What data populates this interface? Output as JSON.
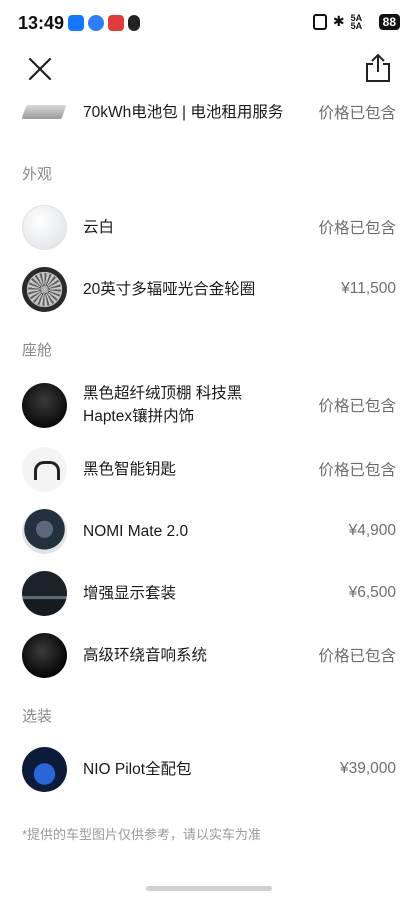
{
  "status_bar": {
    "time": "13:49",
    "battery": "88",
    "signal": "5A 5A"
  },
  "items_top": [
    {
      "name": "70kWh电池包 | 电池租用服务",
      "price": "价格已包含",
      "thumb": "battery-pack"
    }
  ],
  "sections": [
    {
      "title": "外观",
      "items": [
        {
          "name": "云白",
          "price": "价格已包含",
          "thumb": "white-paint"
        },
        {
          "name": "20英寸多辐哑光合金轮圈",
          "price": "¥11,500",
          "thumb": "wheel"
        }
      ]
    },
    {
      "title": "座舱",
      "items": [
        {
          "name": "黑色超纤绒顶棚 科技黑 Haptex镶拼内饰",
          "price": "价格已包含",
          "thumb": "black-interior"
        },
        {
          "name": "黑色智能钥匙",
          "price": "价格已包含",
          "thumb": "smart-key"
        },
        {
          "name": "NOMI Mate 2.0",
          "price": "¥4,900",
          "thumb": "nomi"
        },
        {
          "name": "增强显示套装",
          "price": "¥6,500",
          "thumb": "display"
        },
        {
          "name": "高级环绕音响系统",
          "price": "价格已包含",
          "thumb": "audio"
        }
      ]
    },
    {
      "title": "选装",
      "items": [
        {
          "name": "NIO Pilot全配包",
          "price": "¥39,000",
          "thumb": "car"
        }
      ]
    }
  ],
  "footnote": "*提供的车型图片仅供参考，请以实车为准"
}
